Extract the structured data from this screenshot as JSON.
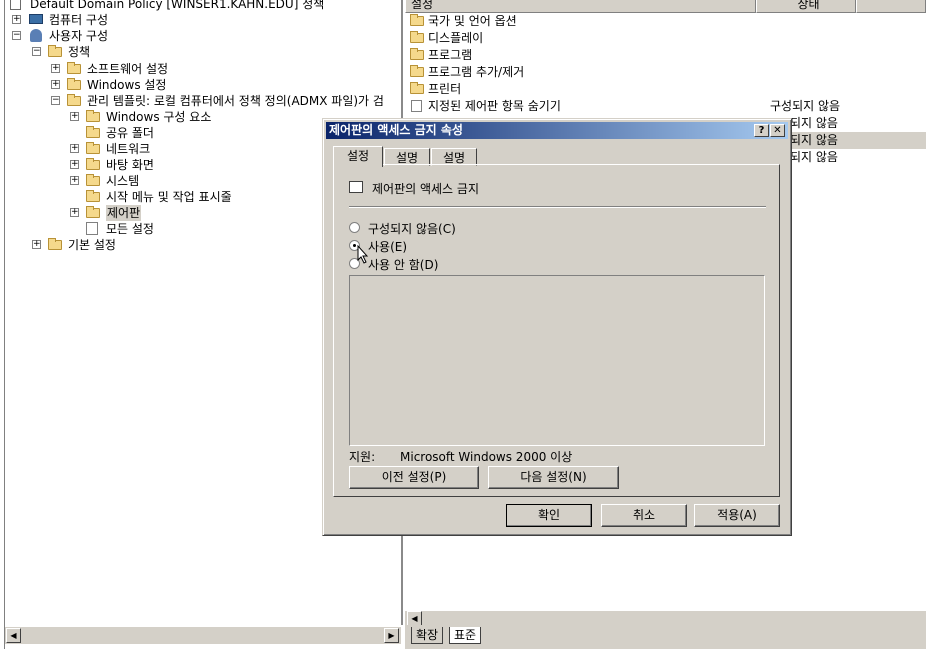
{
  "tree": {
    "root": "Default Domain Policy [WINSER1.KAHN.EDU] 정책",
    "computer_config": "컴퓨터 구성",
    "user_config": "사용자 구성",
    "policy": "정책",
    "software_settings": "소프트웨어 설정",
    "windows_settings": "Windows 설정",
    "admin_templates": "관리 템플릿: 로컬 컴퓨터에서 정책 정의(ADMX 파일)가 검",
    "windows_components": "Windows 구성 요소",
    "shared_folders": "공유 폴더",
    "network": "네트워크",
    "desktop": "바탕 화면",
    "system": "시스템",
    "start_menu": "시작 메뉴 및 작업 표시줄",
    "control_panel": "제어판",
    "all_settings": "모든 설정",
    "preferences": "기본 설정"
  },
  "list": {
    "col_setting": "설정",
    "col_status": "상태",
    "items": [
      {
        "label": "국가 및 언어 옵션",
        "status": ""
      },
      {
        "label": "디스플레이",
        "status": ""
      },
      {
        "label": "프로그램",
        "status": ""
      },
      {
        "label": "프로그램 추가/제거",
        "status": ""
      },
      {
        "label": "프린터",
        "status": ""
      },
      {
        "label": "지정된 제어판 항목 숨기기",
        "status": "구성되지 않음"
      }
    ],
    "partial_status": [
      "되지 않음",
      "되지 않음",
      "되지 않음"
    ]
  },
  "bottom_tabs": {
    "extended": "확장",
    "standard": "표준"
  },
  "dialog": {
    "title": "제어판의 액세스 금지 속성",
    "help": "?",
    "close": "✕",
    "tabs": [
      "설정",
      "설명",
      "설명"
    ],
    "setting_name": "제어판의 액세스 금지",
    "options": {
      "not_configured": "구성되지 않음(C)",
      "enabled": "사용(E)",
      "disabled": "사용 안 함(D)"
    },
    "selected": "enabled",
    "supported_label": "지원:",
    "supported_value": "Microsoft Windows 2000 이상",
    "prev_button": "이전 설정(P)",
    "next_button": "다음 설정(N)",
    "ok_button": "확인",
    "cancel_button": "취소",
    "apply_button": "적용(A)"
  }
}
